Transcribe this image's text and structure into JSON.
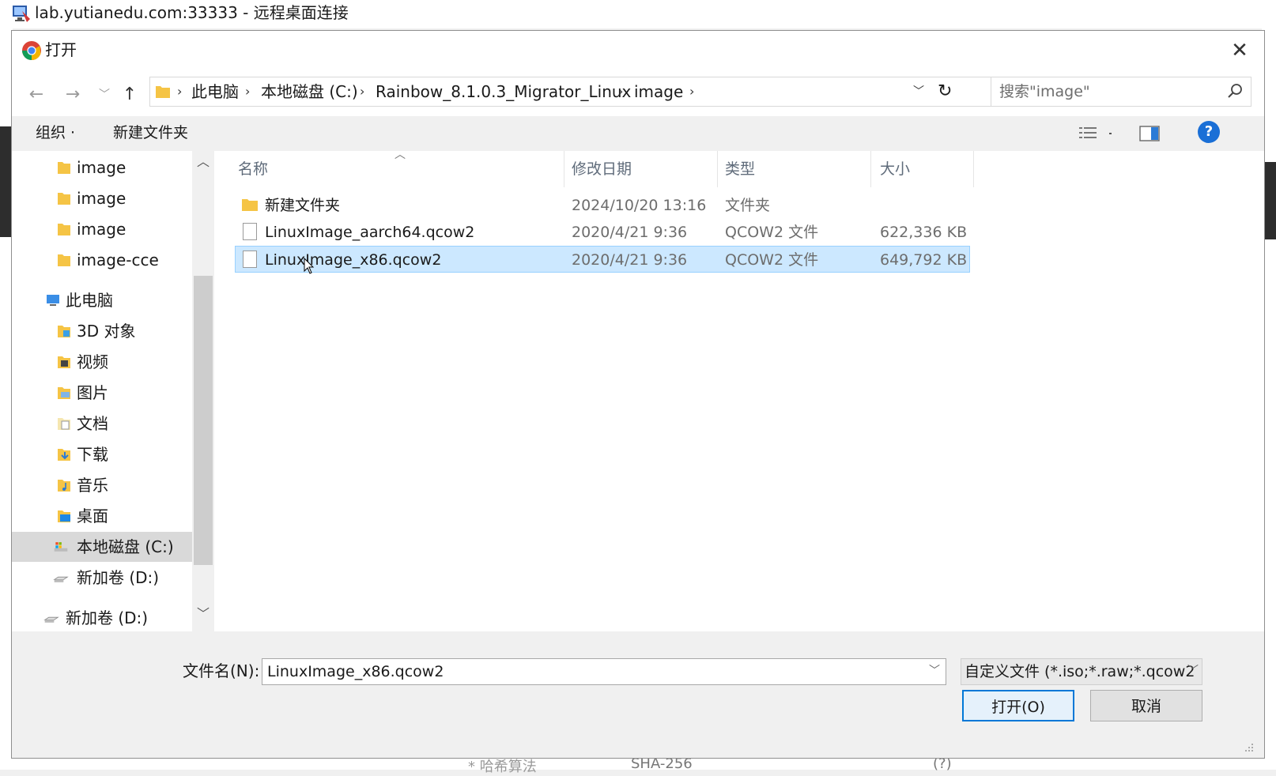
{
  "rdp": {
    "title": "lab.yutianedu.com:33333 - 远程桌面连接",
    "icon": "remote-desktop-icon"
  },
  "dialog": {
    "title": "打开",
    "icon": "chrome-icon",
    "close_icon": "close-icon"
  },
  "nav": {
    "back_icon": "back-arrow-icon",
    "forward_icon": "forward-arrow-icon",
    "recent_icon": "chevron-down-icon",
    "up_icon": "up-arrow-icon",
    "breadcrumbs": [
      "此电脑",
      "本地磁盘 (C:)",
      "Rainbow_8.1.0.3_Migrator_Linux",
      "image"
    ],
    "refresh_icon": "refresh-icon",
    "search_placeholder": "搜索\"image\"",
    "search_icon": "search-icon"
  },
  "toolbar": {
    "organize": "组织 ·",
    "new_folder": "新建文件夹",
    "view_icon": "details-view-icon",
    "preview_icon": "preview-pane-icon",
    "help": "?"
  },
  "sidebar": {
    "items": [
      {
        "label": "image",
        "icon": "folder-icon"
      },
      {
        "label": "image",
        "icon": "folder-icon"
      },
      {
        "label": "image",
        "icon": "folder-icon"
      },
      {
        "label": "image-cce",
        "icon": "folder-icon"
      },
      {
        "label": "此电脑",
        "icon": "computer-icon"
      },
      {
        "label": "3D 对象",
        "icon": "3d-objects-icon"
      },
      {
        "label": "视频",
        "icon": "videos-icon"
      },
      {
        "label": "图片",
        "icon": "pictures-icon"
      },
      {
        "label": "文档",
        "icon": "documents-icon"
      },
      {
        "label": "下载",
        "icon": "downloads-icon"
      },
      {
        "label": "音乐",
        "icon": "music-icon"
      },
      {
        "label": "桌面",
        "icon": "desktop-icon"
      },
      {
        "label": "本地磁盘 (C:)",
        "icon": "local-disk-icon"
      },
      {
        "label": "新加卷 (D:)",
        "icon": "drive-icon"
      },
      {
        "label": "新加卷 (D:)",
        "icon": "drive-icon"
      }
    ],
    "selected_index": 12
  },
  "files": {
    "columns": [
      "名称",
      "修改日期",
      "类型",
      "大小"
    ],
    "rows": [
      {
        "name": "新建文件夹",
        "date": "2024/10/20 13:16",
        "type": "文件夹",
        "size": "",
        "icon": "folder-icon"
      },
      {
        "name": "LinuxImage_aarch64.qcow2",
        "date": "2020/4/21 9:36",
        "type": "QCOW2 文件",
        "size": "622,336 KB",
        "icon": "file-icon"
      },
      {
        "name": "LinuxImage_x86.qcow2",
        "date": "2020/4/21 9:36",
        "type": "QCOW2 文件",
        "size": "649,792 KB",
        "icon": "file-icon"
      }
    ],
    "selected_index": 2
  },
  "bottom": {
    "filename_label": "文件名(N):",
    "filename_value": "LinuxImage_x86.qcow2",
    "filter": "自定义文件 (*.iso;*.raw;*.qcow2",
    "open_button": "打开(O)",
    "cancel_button": "取消"
  },
  "background": {
    "hash_label": "* 哈希算法",
    "hash_value": "SHA-256",
    "help_hint": "(?)"
  },
  "colors": {
    "selection": "#cce8ff",
    "selection_border": "#99d1ff",
    "accent": "#0078d7",
    "help_blue": "#1a6fd6"
  }
}
